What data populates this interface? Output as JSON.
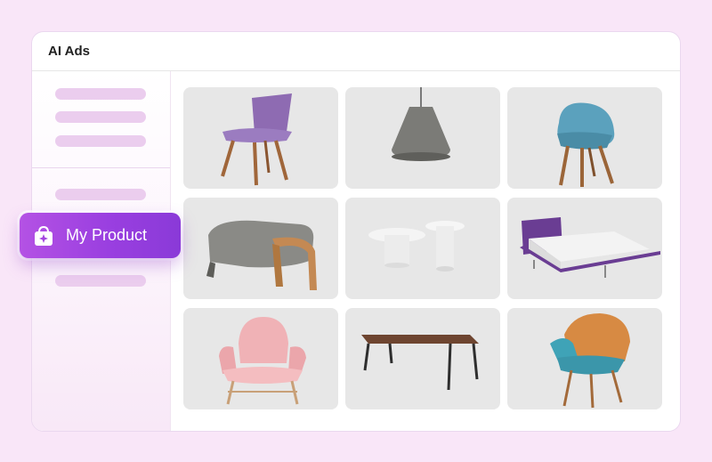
{
  "window": {
    "title": "AI Ads"
  },
  "sidebar": {
    "selected_item": {
      "label": "My Product",
      "icon": "shopping-bag-sparkle-icon"
    }
  },
  "products": [
    {
      "name": "purple-side-chair"
    },
    {
      "name": "gray-pendant-lamp"
    },
    {
      "name": "blue-lounge-chair"
    },
    {
      "name": "gray-ottoman"
    },
    {
      "name": "white-side-tables"
    },
    {
      "name": "purple-bed"
    },
    {
      "name": "pink-lounge-chair"
    },
    {
      "name": "wood-dining-table"
    },
    {
      "name": "orange-blue-armchair"
    }
  ],
  "colors": {
    "background": "#f9e6f8",
    "accent": "#9a3fe0",
    "skeleton": "#ebcdee",
    "tile": "#e7e7e7"
  }
}
